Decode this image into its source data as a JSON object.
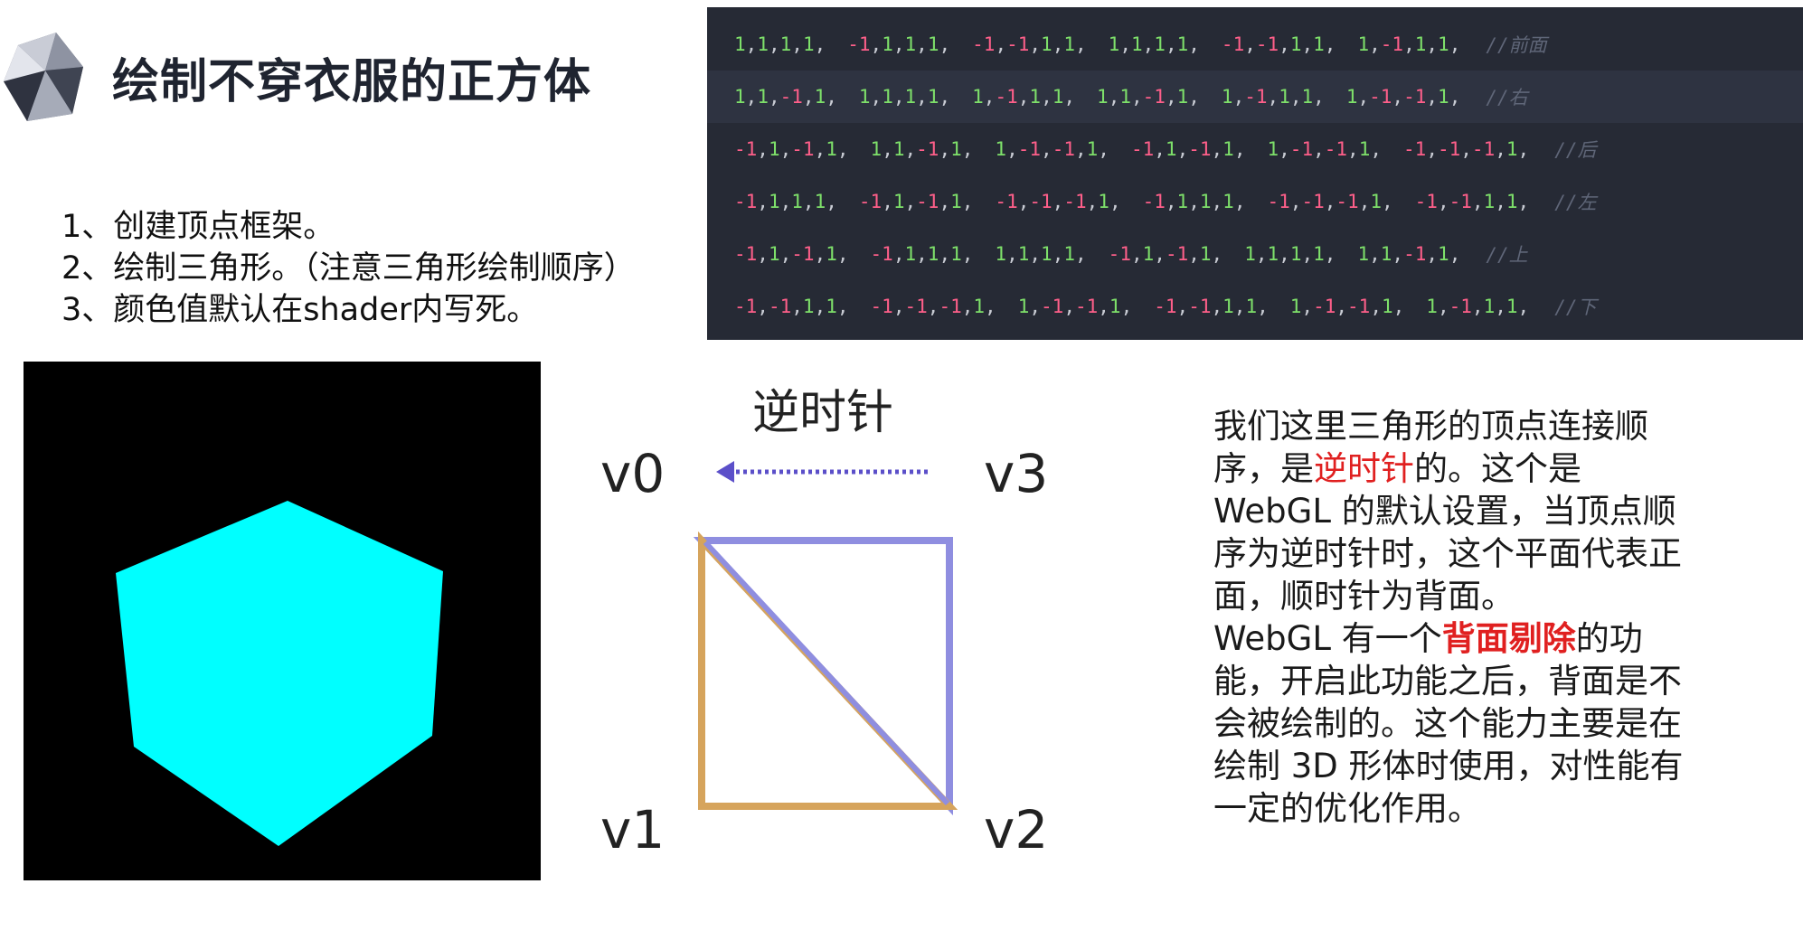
{
  "header": {
    "title": "绘制不穿衣服的正方体",
    "logo_icon": "crystal-logo-icon"
  },
  "steps": [
    "1、创建顶点框架。",
    "2、绘制三角形。（注意三角形绘制顺序）",
    "3、颜色值默认在shader内写死。"
  ],
  "code": {
    "lines": [
      {
        "groups": [
          [
            "1",
            "1",
            "1",
            "1"
          ],
          [
            "-1",
            "1",
            "1",
            "1"
          ],
          [
            "-1",
            "-1",
            "1",
            "1"
          ],
          [
            "1",
            "1",
            "1",
            "1"
          ],
          [
            "-1",
            "-1",
            "1",
            "1"
          ],
          [
            "1",
            "-1",
            "1",
            "1"
          ]
        ],
        "comment": "//前面",
        "highlighted": false
      },
      {
        "groups": [
          [
            "1",
            "1",
            "-1",
            "1"
          ],
          [
            "1",
            "1",
            "1",
            "1"
          ],
          [
            "1",
            "-1",
            "1",
            "1"
          ],
          [
            "1",
            "1",
            "-1",
            "1"
          ],
          [
            "1",
            "-1",
            "1",
            "1"
          ],
          [
            "1",
            "-1",
            "-1",
            "1"
          ]
        ],
        "comment": "//右",
        "highlighted": true
      },
      {
        "groups": [
          [
            "-1",
            "1",
            "-1",
            "1"
          ],
          [
            "1",
            "1",
            "-1",
            "1"
          ],
          [
            "1",
            "-1",
            "-1",
            "1"
          ],
          [
            "-1",
            "1",
            "-1",
            "1"
          ],
          [
            "1",
            "-1",
            "-1",
            "1"
          ],
          [
            "-1",
            "-1",
            "-1",
            "1"
          ]
        ],
        "comment": "//后",
        "highlighted": false
      },
      {
        "groups": [
          [
            "-1",
            "1",
            "1",
            "1"
          ],
          [
            "-1",
            "1",
            "-1",
            "1"
          ],
          [
            "-1",
            "-1",
            "-1",
            "1"
          ],
          [
            "-1",
            "1",
            "1",
            "1"
          ],
          [
            "-1",
            "-1",
            "-1",
            "1"
          ],
          [
            "-1",
            "-1",
            "1",
            "1"
          ]
        ],
        "comment": "//左",
        "highlighted": false
      },
      {
        "groups": [
          [
            "-1",
            "1",
            "-1",
            "1"
          ],
          [
            "-1",
            "1",
            "1",
            "1"
          ],
          [
            "1",
            "1",
            "1",
            "1"
          ],
          [
            "-1",
            "1",
            "-1",
            "1"
          ],
          [
            "1",
            "1",
            "1",
            "1"
          ],
          [
            "1",
            "1",
            "-1",
            "1"
          ]
        ],
        "comment": "//上",
        "highlighted": false
      },
      {
        "groups": [
          [
            "-1",
            "-1",
            "1",
            "1"
          ],
          [
            "-1",
            "-1",
            "-1",
            "1"
          ],
          [
            "1",
            "-1",
            "-1",
            "1"
          ],
          [
            "-1",
            "-1",
            "1",
            "1"
          ],
          [
            "1",
            "-1",
            "-1",
            "1"
          ],
          [
            "1",
            "-1",
            "1",
            "1"
          ]
        ],
        "comment": "//下",
        "highlighted": false
      }
    ],
    "colors": {
      "positive": "#7ee06a",
      "negative": "#ff5f8a",
      "comment": "#5f6678",
      "background": "#262a35"
    }
  },
  "cube": {
    "face_color": "#00ffff",
    "background": "#000000"
  },
  "diagram": {
    "heading": "逆时针",
    "v0": "v0",
    "v1": "v1",
    "v2": "v2",
    "v3": "v3",
    "arrow_color": "#5b4fc9",
    "triangle_a_color": "#8f8ee0",
    "triangle_b_color": "#d6a45c"
  },
  "explanation": {
    "p1_before": "我们这里三角形的顶点连接顺序，是",
    "p1_red": "逆时针",
    "p1_after": "的。这个是 WebGL 的默认设置，当顶点顺序为逆时针时，这个平面代表正面，顺时针为背面。",
    "p2_before": "WebGL 有一个",
    "p2_red": "背面剔除",
    "p2_after": "的功能，开启此功能之后，背面是不会被绘制的。这个能力主要是在绘制 3D 形体时使用，对性能有一定的优化作用。"
  }
}
